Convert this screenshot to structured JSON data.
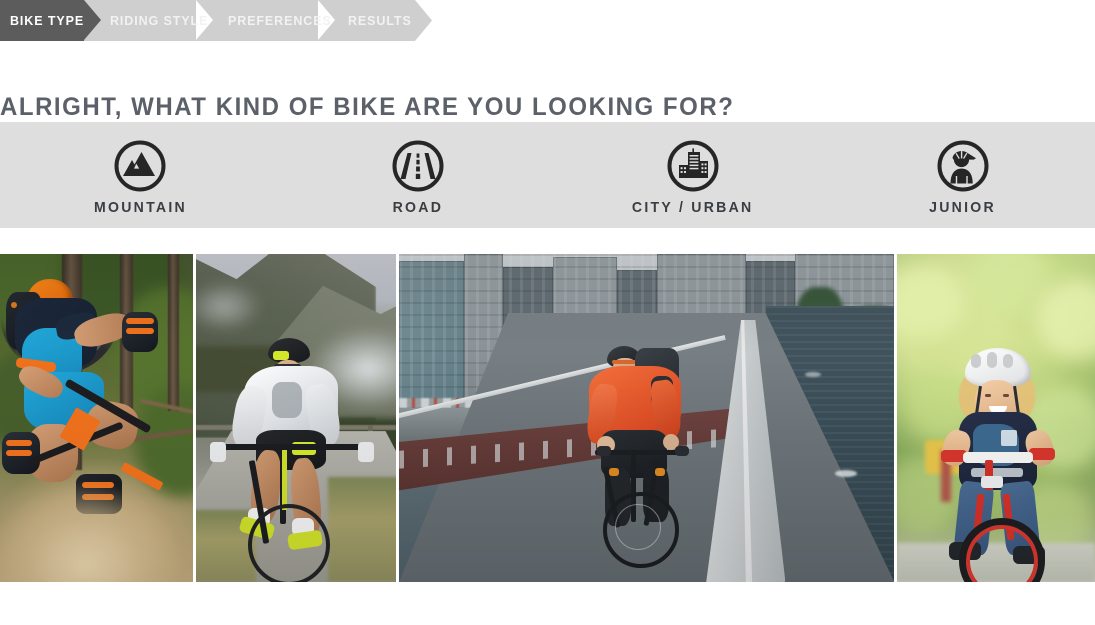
{
  "steps": [
    {
      "label": "BIKE TYPE",
      "state": "active"
    },
    {
      "label": "RIDING STYLE",
      "state": "inactive"
    },
    {
      "label": "PREFERENCES",
      "state": "inactive"
    },
    {
      "label": "RESULTS",
      "state": "inactive"
    }
  ],
  "page": {
    "title": "ALRIGHT, WHAT KIND OF BIKE ARE YOU LOOKING FOR?"
  },
  "categories": [
    {
      "label": "MOUNTAIN",
      "icon": "mountain-icon"
    },
    {
      "label": "ROAD",
      "icon": "road-icon"
    },
    {
      "label": "CITY / URBAN",
      "icon": "city-icon"
    },
    {
      "label": "JUNIOR",
      "icon": "junior-icon"
    }
  ],
  "photos": [
    {
      "name": "mountain-photo",
      "alt": "Mountain biker in orange helmet riding a dusty forest trail"
    },
    {
      "name": "road-photo",
      "alt": "Road cyclist in white jacket climbing an alpine mountain road"
    },
    {
      "name": "city-photo",
      "alt": "Urban commuter in orange jacket riding across a river bridge"
    },
    {
      "name": "junior-photo",
      "alt": "Smiling child in white helmet on a red balance bike"
    }
  ],
  "colors": {
    "step_active_bg": "#5c5c5c",
    "step_inactive_bg": "#cfcfcf",
    "step_inactive_text": "#f2f2f2",
    "title_text": "#5b6069",
    "category_bar_bg": "#dedede",
    "category_label_text": "#3a3d42",
    "icon_stroke": "#262626",
    "page_bg": "#ffffff"
  }
}
